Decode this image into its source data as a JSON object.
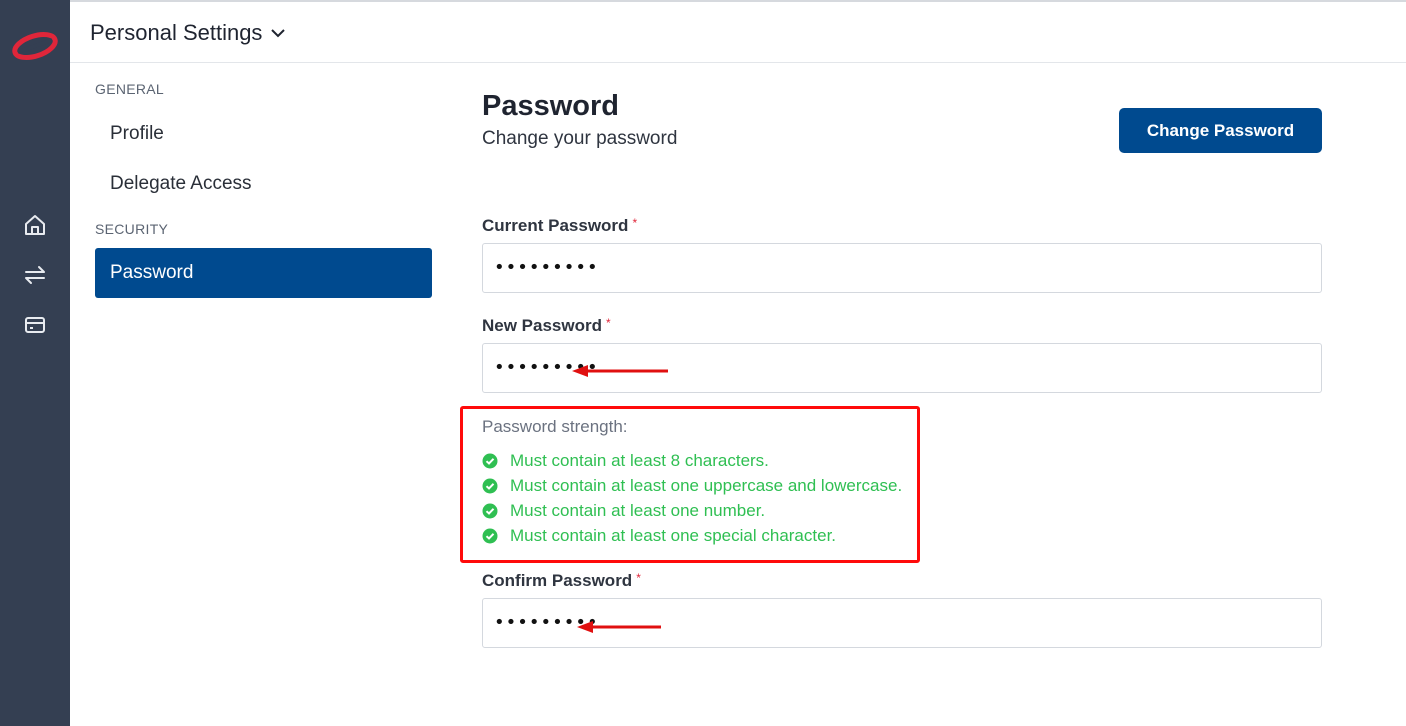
{
  "colors": {
    "rail_bg": "#343f52",
    "brand_red": "#e0263a",
    "primary": "#004a8f",
    "success": "#2fbf52",
    "highlight_box": "#ff0a0a"
  },
  "rail": {
    "logo": "brand-logo",
    "icons": [
      "home-icon",
      "transfer-arrows-icon",
      "card-icon"
    ]
  },
  "header": {
    "title": "Personal Settings",
    "chevron": "chevron-down-icon"
  },
  "nav": {
    "general_heading": "GENERAL",
    "items_general": [
      {
        "label": "Profile"
      },
      {
        "label": "Delegate Access"
      }
    ],
    "security_heading": "SECURITY",
    "items_security": [
      {
        "label": "Password",
        "active": true
      }
    ]
  },
  "main": {
    "title": "Password",
    "subtitle": "Change your password",
    "change_button": "Change Password",
    "current_password": {
      "label": "Current Password",
      "required_mark": "*",
      "value": "•••••••••"
    },
    "new_password": {
      "label": "New Password",
      "required_mark": "*",
      "value": "•••••••••"
    },
    "confirm_password": {
      "label": "Confirm Password",
      "required_mark": "*",
      "value": "•••••••••"
    },
    "strength": {
      "title": "Password strength:",
      "rules": [
        {
          "text": "Must contain at least 8 characters.",
          "met": true
        },
        {
          "text": "Must contain at least one uppercase and lowercase.",
          "met": true
        },
        {
          "text": "Must contain at least one number.",
          "met": true
        },
        {
          "text": "Must contain at least one special character.",
          "met": true
        }
      ]
    }
  }
}
